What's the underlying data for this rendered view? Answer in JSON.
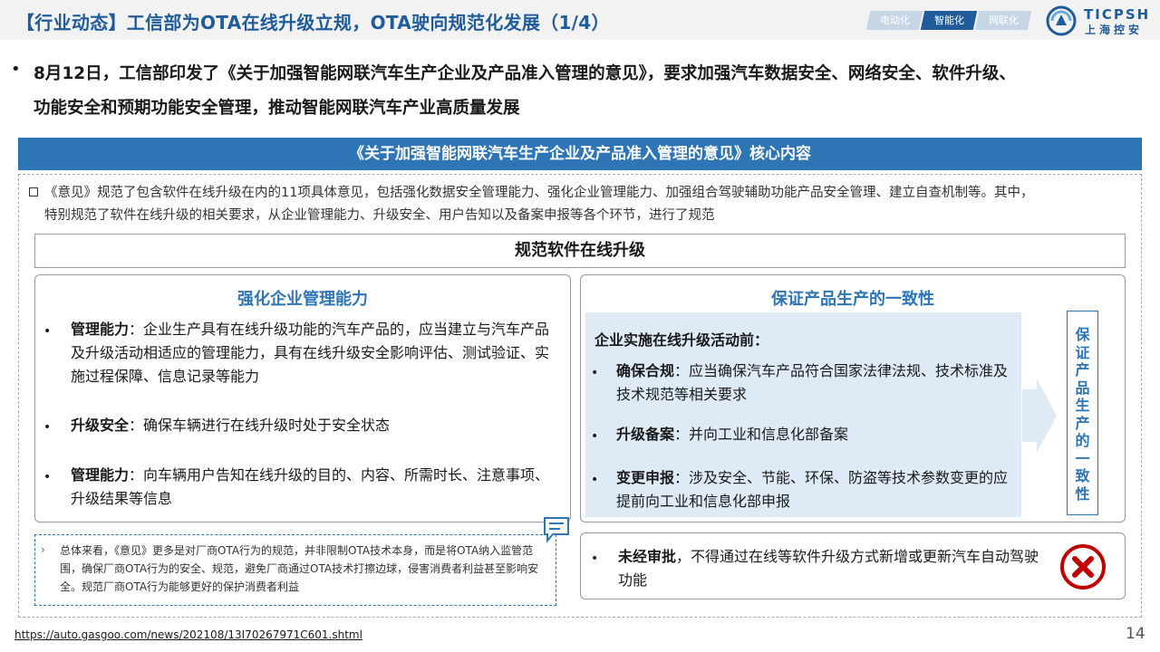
{
  "header": {
    "title": "【行业动态】工信部为OTA在线升级立规，OTA驶向规范化发展（1/4）",
    "tags": [
      {
        "label": "电动化",
        "active": false
      },
      {
        "label": "智能化",
        "active": true
      },
      {
        "label": "网联化",
        "active": false
      }
    ],
    "logo_en": "TICPSH",
    "logo_cn": "上海控安"
  },
  "intro": {
    "bullet": "•",
    "line1": "8月12日，工信部印发了《关于加强智能网联汽车生产企业及产品准入管理的意见》，要求加强汽车数据安全、网络安全、软件升级、",
    "line2": "功能安全和预期功能安全管理，推动智能网联汽车产业高质量发展"
  },
  "banner": "《关于加强智能网联汽车生产企业及产品准入管理的意见》核心内容",
  "summary": {
    "line1": "《意见》规范了包含软件在线升级在内的11项具体意见，包括强化数据安全管理能力、强化企业管理能力、加强组合驾驶辅助功能产品安全管理、建立自查机制等。其中，",
    "line2": "特别规范了软件在线升级的相关要求，从企业管理能力、升级安全、用户告知以及备案申报等各个环节，进行了规范"
  },
  "section_title": "规范软件在线升级",
  "left_panel": {
    "title": "强化企业管理能力",
    "items": [
      {
        "label": "管理能力",
        "sep": "：",
        "text": "企业生产具有在线升级功能的汽车产品的，应当建立与汽车产品及升级活动相适应的管理能力，具有在线升级安全影响评估、测试验证、实施过程保障、信息记录等能力"
      },
      {
        "label": "升级安全",
        "sep": "：",
        "text": "确保车辆进行在线升级时处于安全状态"
      },
      {
        "label": "管理能力",
        "sep": "：",
        "text": "向车辆用户告知在线升级的目的、内容、所需时长、注意事项、升级结果等信息"
      }
    ]
  },
  "right_panel": {
    "title": "保证产品生产的一致性",
    "subtitle": "企业实施在线升级活动前：",
    "items": [
      {
        "label": "确保合规",
        "sep": "：",
        "text": "应当确保汽车产品符合国家法律法规、技术标准及技术规范等相关要求"
      },
      {
        "label": "升级备案",
        "sep": "：",
        "text": "并向工业和信息化部备案"
      },
      {
        "label": "变更申报",
        "sep": "：",
        "text": "涉及安全、节能、环保、防盗等技术参数变更的应提前向工业和信息化部申报"
      }
    ],
    "vertical_label": [
      "保",
      "证",
      "产",
      "品",
      "生",
      "产",
      "的",
      "一",
      "致",
      "性"
    ]
  },
  "note": {
    "chevron": "›",
    "text": "总体来看，《意见》更多是对厂商OTA行为的规范，并非限制OTA技术本身，而是将OTA纳入监管范围，确保厂商OTA行为的安全、规范，避免厂商通过OTA技术打擦边球，侵害消费者利益甚至影响安全。规范厂商OTA行为能够更好的保护消费者利益"
  },
  "prohibition": {
    "label": "未经审批",
    "sep": "，",
    "text": "不得通过在线等软件升级方式新增或更新汽车自动驾驶功能"
  },
  "footer": {
    "url": "https://auto.gasgoo.com/news/202108/13I70267971C601.shtml",
    "page": "14"
  },
  "colors": {
    "brand": "#1f5c99",
    "accent": "#2e75b6",
    "inner_bg": "#deeaf5",
    "danger": "#c00000"
  }
}
